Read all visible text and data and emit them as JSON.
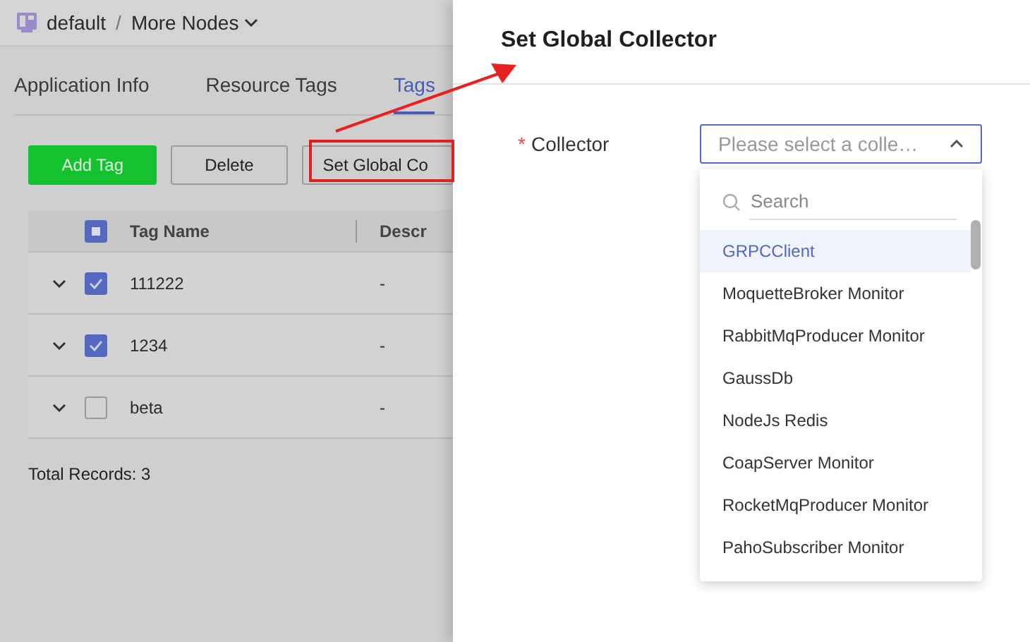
{
  "breadcrumb": {
    "workspace": "default",
    "separator": "/",
    "current": "More Nodes"
  },
  "tabs": [
    {
      "label": "Application Info",
      "selected": false
    },
    {
      "label": "Resource Tags",
      "selected": false
    },
    {
      "label": "Tags",
      "selected": true
    }
  ],
  "toolbar": {
    "buttons": [
      {
        "label": "Add Tag",
        "kind": "primary"
      },
      {
        "label": "Delete",
        "kind": "default"
      },
      {
        "label": "Set Global Co",
        "kind": "default"
      }
    ]
  },
  "table": {
    "header_indeterminate": true,
    "columns": [
      "Tag Name",
      "Descr"
    ],
    "rows": [
      {
        "name": "111222",
        "description": "-",
        "checked": true
      },
      {
        "name": "1234",
        "description": "-",
        "checked": true
      },
      {
        "name": "beta",
        "description": "-",
        "checked": false
      }
    ]
  },
  "total": "Total Records: 3",
  "drawer": {
    "title": "Set Global Collector",
    "field": {
      "required_mark": "*",
      "label": "Collector",
      "placeholder": "Please select a colle…",
      "expanded": true
    },
    "dropdown": {
      "search_placeholder": "Search",
      "options": [
        {
          "label": "GRPCClient",
          "selected": true
        },
        {
          "label": "MoquetteBroker Monitor",
          "selected": false
        },
        {
          "label": "RabbitMqProducer Monitor",
          "selected": false
        },
        {
          "label": "GaussDb",
          "selected": false
        },
        {
          "label": "NodeJs Redis",
          "selected": false
        },
        {
          "label": "CoapServer Monitor",
          "selected": false
        },
        {
          "label": "RocketMqProducer Monitor",
          "selected": false
        },
        {
          "label": "PahoSubscriber Monitor",
          "selected": false
        }
      ]
    }
  }
}
